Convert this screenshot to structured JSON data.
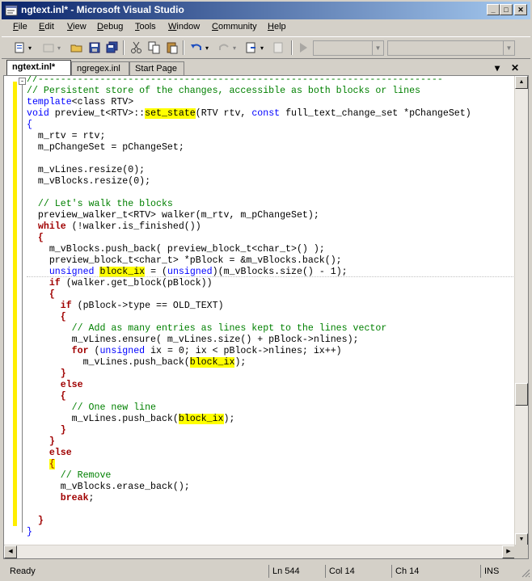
{
  "window": {
    "title": "ngtext.inl* - Microsoft Visual Studio",
    "minimize_glyph": "_",
    "maximize_glyph": "□",
    "close_glyph": "✕"
  },
  "menu": {
    "items": [
      {
        "accel": "F",
        "rest": "ile"
      },
      {
        "accel": "E",
        "rest": "dit"
      },
      {
        "accel": "V",
        "rest": "iew"
      },
      {
        "accel": "D",
        "rest": "ebug"
      },
      {
        "accel": "T",
        "rest": "ools"
      },
      {
        "accel": "W",
        "rest": "indow"
      },
      {
        "accel": "C",
        "rest": "ommunity"
      },
      {
        "accel": "H",
        "rest": "elp"
      }
    ]
  },
  "tabs": {
    "items": [
      "ngtext.inl*",
      "ngregex.inl",
      "Start Page"
    ],
    "dropdown_glyph": "▾",
    "close_glyph": "✕"
  },
  "code": {
    "l1": "//------------------------------------------------------------------------",
    "l2": "// Persistent store of the changes, accessible as both blocks or lines",
    "l3a": "template",
    "l3b": "<class RTV>",
    "l4a": "void",
    "l4b": " preview_t<RTV>::",
    "l4c": "set_state",
    "l4d": "(RTV rtv, ",
    "l4e": "const",
    "l4f": " full_text_change_set *pChangeSet)",
    "l5": "{",
    "l6": "  m_rtv = rtv;",
    "l7": "  m_pChangeSet = pChangeSet;",
    "l8": "",
    "l9": "  m_vLines.resize(0);",
    "l10": "  m_vBlocks.resize(0);",
    "l11": "",
    "l12": "  // Let's walk the blocks",
    "l13": "  preview_walker_t<RTV> walker(m_rtv, m_pChangeSet);",
    "l14a": "  while",
    "l14b": " (!walker.is_finished())",
    "l15": "  {",
    "l16": "    m_vBlocks.push_back( preview_block_t<char_t>() );",
    "l17": "    preview_block_t<char_t> *pBlock = &m_vBlocks.back();",
    "l18a": "    unsigned",
    "l18b": " ",
    "l18c": "block_ix",
    "l18d": " = (",
    "l18e": "unsigned",
    "l18f": ")(m_vBlocks.size() - 1);",
    "l19a": "    if",
    "l19b": " (walker.get_block(pBlock))",
    "l20": "    {",
    "l21a": "      if",
    "l21b": " (pBlock->type == OLD_TEXT)",
    "l22": "      {",
    "l23": "        // Add as many entries as lines kept to the lines vector",
    "l24": "        m_vLines.ensure( m_vLines.size() + pBlock->nlines);",
    "l25a": "        for",
    "l25b": " (",
    "l25c": "unsigned",
    "l25d": " ix = 0; ix < pBlock->nlines; ix++)",
    "l26a": "          m_vLines.push_back(",
    "l26b": "block_ix",
    "l26c": ");",
    "l27": "      }",
    "l28": "      else",
    "l29": "      {",
    "l30": "        // One new line",
    "l31a": "        m_vLines.push_back(",
    "l31b": "block_ix",
    "l31c": ");",
    "l32": "      }",
    "l33": "    }",
    "l34": "    else",
    "l35": "    {",
    "l36": "      // Remove",
    "l37": "      m_vBlocks.erase_back();",
    "l38": "      break",
    "l38b": ";",
    "l39": "",
    "l40": "  }",
    "l41": "}"
  },
  "outline": {
    "collapse_glyph": "⊟",
    "box_glyph": "-"
  },
  "status": {
    "ready": "Ready",
    "line": "Ln 544",
    "col": "Col 14",
    "ch": "Ch 14",
    "mode": "INS"
  },
  "colors": {
    "keyword": "#0000ff",
    "flow_keyword": "#a00000",
    "comment": "#008000",
    "highlight": "#ffff00",
    "titlebar_start": "#0a246a",
    "titlebar_end": "#a6caf0"
  }
}
